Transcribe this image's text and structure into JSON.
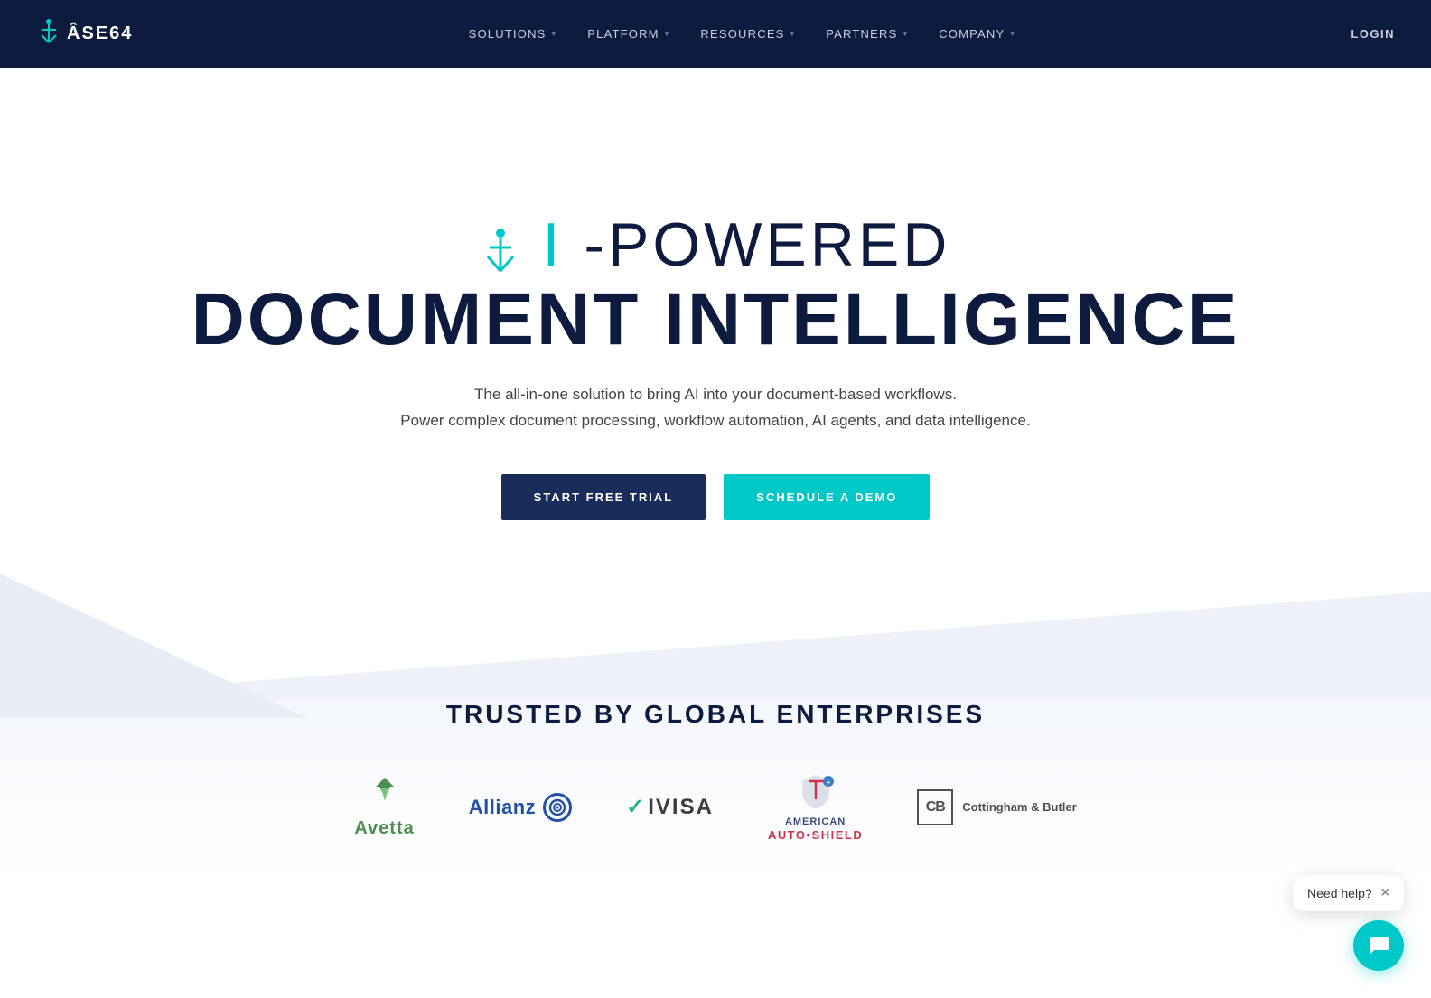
{
  "nav": {
    "logo_text": "BASE64",
    "logo_prefix": "B",
    "links": [
      {
        "label": "SOLUTIONS",
        "has_dropdown": true
      },
      {
        "label": "PLATFORM",
        "has_dropdown": true
      },
      {
        "label": "RESOURCES",
        "has_dropdown": true
      },
      {
        "label": "PARTNERS",
        "has_dropdown": true
      },
      {
        "label": "COMPANY",
        "has_dropdown": true
      }
    ],
    "login_label": "LOGIN"
  },
  "hero": {
    "ai_line": "-POWERED",
    "ai_letter": "AI",
    "doc_line": "DOCUMENT INTELLIGENCE",
    "subtitle_line1": "The all-in-one solution to bring AI into your document-based workflows.",
    "subtitle_line2": "Power complex document processing, workflow automation, AI agents, and data intelligence.",
    "btn_trial": "START FREE TRIAL",
    "btn_demo": "SCHEDULE A DEMO"
  },
  "trusted": {
    "title": "TRUSTED BY GLOBAL ENTERPRISES",
    "logos": [
      {
        "name": "Avetta"
      },
      {
        "name": "Allianz"
      },
      {
        "name": "IVISA"
      },
      {
        "name": "American Auto Shield"
      },
      {
        "name": "Cottingham & Butler"
      }
    ]
  },
  "chat": {
    "need_help": "Need help?",
    "close_label": "×"
  },
  "colors": {
    "navy": "#0d1b3e",
    "cyan": "#00c8c8",
    "white": "#ffffff"
  }
}
